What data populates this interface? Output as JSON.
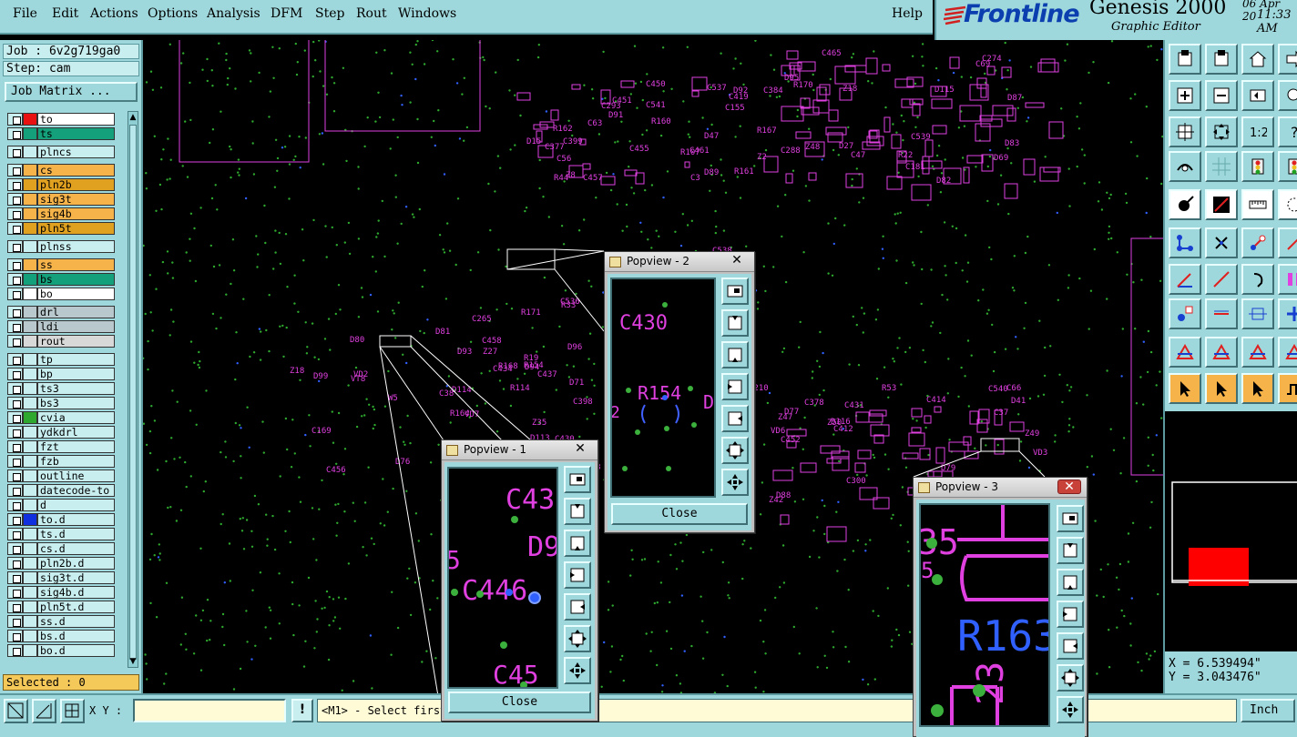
{
  "menubar": {
    "items": [
      "File",
      "Edit",
      "Actions",
      "Options",
      "Analysis",
      "DFM",
      "Step",
      "Rout",
      "Windows"
    ],
    "help": "Help"
  },
  "brand": {
    "logo": "Frontline",
    "title": "Genesis 2000",
    "subtitle": "Graphic Editor",
    "date": "06 Apr 20",
    "time": "11:33 AM"
  },
  "job": {
    "job_label": "Job : 6v2g719ga0",
    "step_label": "Step: cam",
    "matrix_button": "Job Matrix ..."
  },
  "layers": [
    {
      "name": "to",
      "color": "#ffffff",
      "swatch": "#e81010"
    },
    {
      "name": "ts",
      "color": "#14a07a",
      "swatch": "#14a07a"
    },
    {
      "name": "plncs",
      "color": "#c8eef0",
      "swatch": "#c8eef0"
    },
    {
      "name": "cs",
      "color": "#f5b34a",
      "swatch": "#f5b34a"
    },
    {
      "name": "pln2b",
      "color": "#e0a020",
      "swatch": "#e0a020"
    },
    {
      "name": "sig3t",
      "color": "#f5b34a",
      "swatch": "#f5b34a"
    },
    {
      "name": "sig4b",
      "color": "#f5b34a",
      "swatch": "#f5b34a"
    },
    {
      "name": "pln5t",
      "color": "#e0a020",
      "swatch": "#e0a020"
    },
    {
      "name": "plnss",
      "color": "#c8eef0",
      "swatch": "#c8eef0"
    },
    {
      "name": "ss",
      "color": "#f5b34a",
      "swatch": "#f5b34a"
    },
    {
      "name": "bs",
      "color": "#14a07a",
      "swatch": "#14a07a"
    },
    {
      "name": "bo",
      "color": "#ffffff",
      "swatch": "#ffffff"
    },
    {
      "name": "drl",
      "color": "#b8c8cc",
      "swatch": "#b8c8cc"
    },
    {
      "name": "ldi",
      "color": "#b8c8cc",
      "swatch": "#b8c8cc"
    },
    {
      "name": "rout",
      "color": "#d8d8d8",
      "swatch": "#d8d8d8"
    },
    {
      "name": "tp",
      "color": "#c8eef0",
      "swatch": "#c8eef0"
    },
    {
      "name": "bp",
      "color": "#c8eef0",
      "swatch": "#c8eef0"
    },
    {
      "name": "ts3",
      "color": "#c8eef0",
      "swatch": "#c8eef0"
    },
    {
      "name": "bs3",
      "color": "#c8eef0",
      "swatch": "#c8eef0"
    },
    {
      "name": "cvia",
      "color": "#c8eef0",
      "swatch": "#2ea82e"
    },
    {
      "name": "ydkdrl",
      "color": "#c8eef0",
      "swatch": "#c8eef0"
    },
    {
      "name": "fzt",
      "color": "#c8eef0",
      "swatch": "#c8eef0"
    },
    {
      "name": "fzb",
      "color": "#c8eef0",
      "swatch": "#c8eef0"
    },
    {
      "name": "outline",
      "color": "#c8eef0",
      "swatch": "#c8eef0"
    },
    {
      "name": "datecode-to",
      "color": "#c8eef0",
      "swatch": "#c8eef0"
    },
    {
      "name": "d",
      "color": "#c8eef0",
      "swatch": "#c8eef0"
    },
    {
      "name": "to.d",
      "color": "#c8eef0",
      "swatch": "#1030e0"
    },
    {
      "name": "ts.d",
      "color": "#c8eef0",
      "swatch": "#c8eef0"
    },
    {
      "name": "cs.d",
      "color": "#c8eef0",
      "swatch": "#c8eef0"
    },
    {
      "name": "pln2b.d",
      "color": "#c8eef0",
      "swatch": "#c8eef0"
    },
    {
      "name": "sig3t.d",
      "color": "#c8eef0",
      "swatch": "#c8eef0"
    },
    {
      "name": "sig4b.d",
      "color": "#c8eef0",
      "swatch": "#c8eef0"
    },
    {
      "name": "pln5t.d",
      "color": "#c8eef0",
      "swatch": "#c8eef0"
    },
    {
      "name": "ss.d",
      "color": "#c8eef0",
      "swatch": "#c8eef0"
    },
    {
      "name": "bs.d",
      "color": "#c8eef0",
      "swatch": "#c8eef0"
    },
    {
      "name": "bo.d",
      "color": "#c8eef0",
      "swatch": "#c8eef0"
    }
  ],
  "selected_label": "Selected : 0",
  "coords": {
    "x": "X = 6.539494\"",
    "y": "Y = 3.043476\""
  },
  "status": {
    "xy_label": "X Y :",
    "xy_value": "",
    "warn": "!",
    "prompt": "<M1> - Select first",
    "unit": "Inch"
  },
  "popviews": [
    {
      "title": "Popview - 1",
      "close": "Close",
      "labels": [
        "C43",
        "D9",
        "5",
        "C446",
        "C45"
      ]
    },
    {
      "title": "Popview - 2",
      "close": "Close",
      "labels": [
        "C430",
        "R154",
        "D",
        "2"
      ]
    },
    {
      "title": "Popview - 3",
      "close": "Close",
      "labels": [
        "35",
        "R163",
        "23",
        "5"
      ]
    }
  ],
  "board_labels": [
    "C430",
    "R154",
    "Z48",
    "D79",
    "D15",
    "C425",
    "D81",
    "D82",
    "Z42",
    "C399",
    "C398",
    "D80",
    "D87",
    "Z47",
    "D91",
    "Z35",
    "D76",
    "D83",
    "D77",
    "C450",
    "D94",
    "C456",
    "R161",
    "C412",
    "R160",
    "VD6",
    "C434",
    "D69",
    "C37",
    "D89",
    "D96",
    "C437",
    "D92",
    "D88",
    "C455",
    "C43",
    "D93",
    "C419",
    "C414",
    "C457",
    "Z51",
    "C458",
    "Z18",
    "Z49",
    "R162",
    "D71",
    "D99",
    "R170",
    "Z50",
    "C451",
    "C453",
    "VD7",
    "C465",
    "D73",
    "C3",
    "R171",
    "R168",
    "R167",
    "C452",
    "C461",
    "R165",
    "R164",
    "D95",
    "C431",
    "C155",
    "C536",
    "D113",
    "C539",
    "D116",
    "C537",
    "C538",
    "D114",
    "D115",
    "C540",
    "C541",
    "Z19",
    "C169",
    "C181",
    "D41",
    "D47",
    "C210",
    "Z18",
    "R22",
    "C66",
    "Z8",
    "C70",
    "R19",
    "C69",
    "R23",
    "C56",
    "R33",
    "VD2",
    "Z2",
    "C258",
    "R107",
    "R114",
    "C265",
    "C274",
    "C300",
    "C293",
    "C308",
    "VT8",
    "C288",
    "VD3",
    "R44",
    "R49",
    "Z27",
    "D27",
    "R53",
    "C63",
    "R21",
    "C38",
    "C384",
    "C378",
    "C377",
    "R54",
    "W5",
    "C47"
  ]
}
